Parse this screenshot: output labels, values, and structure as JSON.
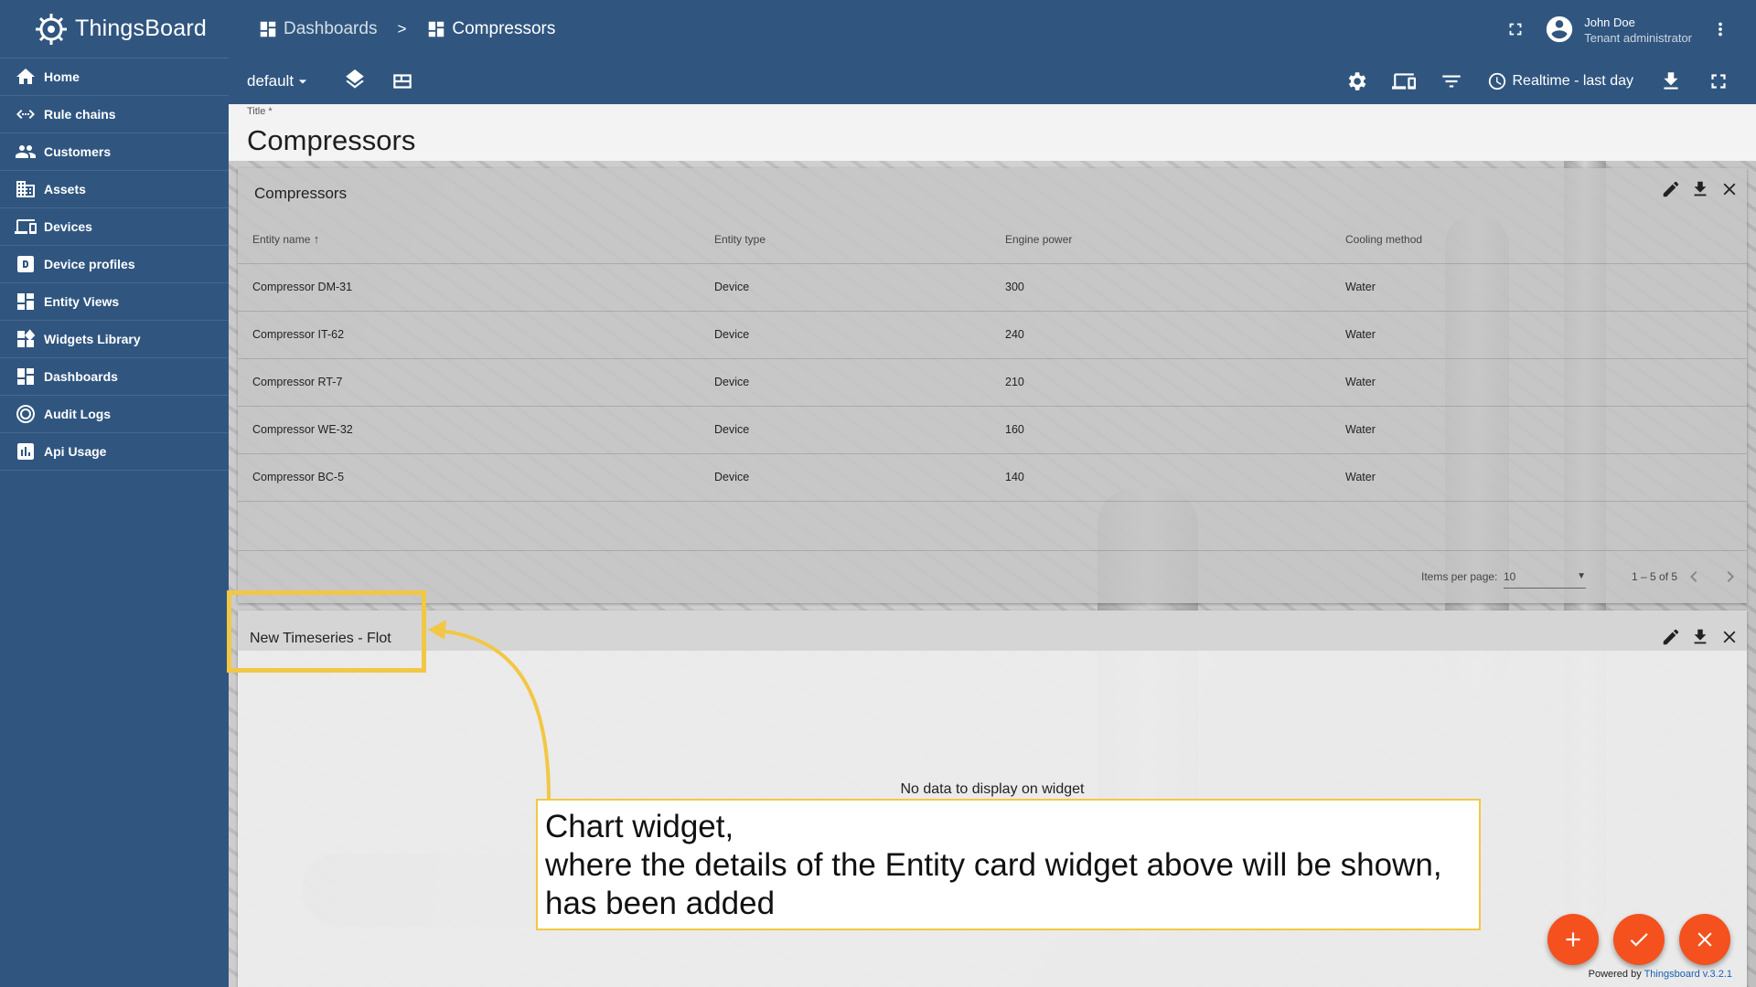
{
  "app": {
    "name": "ThingsBoard"
  },
  "sidebar": {
    "items": [
      {
        "label": "Home",
        "icon": "home-icon"
      },
      {
        "label": "Rule chains",
        "icon": "rule-chains-icon"
      },
      {
        "label": "Customers",
        "icon": "customers-icon"
      },
      {
        "label": "Assets",
        "icon": "assets-icon"
      },
      {
        "label": "Devices",
        "icon": "devices-icon"
      },
      {
        "label": "Device profiles",
        "icon": "device-profiles-icon"
      },
      {
        "label": "Entity Views",
        "icon": "entity-views-icon"
      },
      {
        "label": "Widgets Library",
        "icon": "widgets-icon"
      },
      {
        "label": "Dashboards",
        "icon": "dashboards-icon"
      },
      {
        "label": "Audit Logs",
        "icon": "audit-logs-icon"
      },
      {
        "label": "Api Usage",
        "icon": "api-usage-icon"
      }
    ]
  },
  "header": {
    "breadcrumb": [
      "Dashboards",
      "Compressors"
    ],
    "separator": ">",
    "user": {
      "name": "John Doe",
      "role": "Tenant administrator"
    }
  },
  "toolbar": {
    "layout_state": "default",
    "timewindow": "Realtime - last day"
  },
  "dashboard": {
    "title_label": "Title *",
    "title_value": "Compressors"
  },
  "entities_widget": {
    "title": "Compressors",
    "columns": [
      "Entity name",
      "Entity type",
      "Engine power",
      "Cooling method"
    ],
    "rows": [
      [
        "Compressor DM-31",
        "Device",
        "300",
        "Water"
      ],
      [
        "Compressor IT-62",
        "Device",
        "240",
        "Water"
      ],
      [
        "Compressor RT-7",
        "Device",
        "210",
        "Water"
      ],
      [
        "Compressor WE-32",
        "Device",
        "160",
        "Water"
      ],
      [
        "Compressor BC-5",
        "Device",
        "140",
        "Water"
      ]
    ],
    "pager": {
      "items_per_page_label": "Items per page:",
      "items_per_page": "10",
      "range": "1 – 5 of 5"
    }
  },
  "chart_widget": {
    "title": "New Timeseries - Flot",
    "no_data": "No data to display on widget"
  },
  "callout": {
    "line1": "Chart widget,",
    "line2": "where the details of the Entity card widget above will be shown,",
    "line3": "has been added"
  },
  "footer": {
    "powered_by": "Powered by",
    "version": "Thingsboard v.3.2.1"
  },
  "colors": {
    "primary": "#305680",
    "accent": "#f4511e",
    "highlight": "#f2c744"
  }
}
